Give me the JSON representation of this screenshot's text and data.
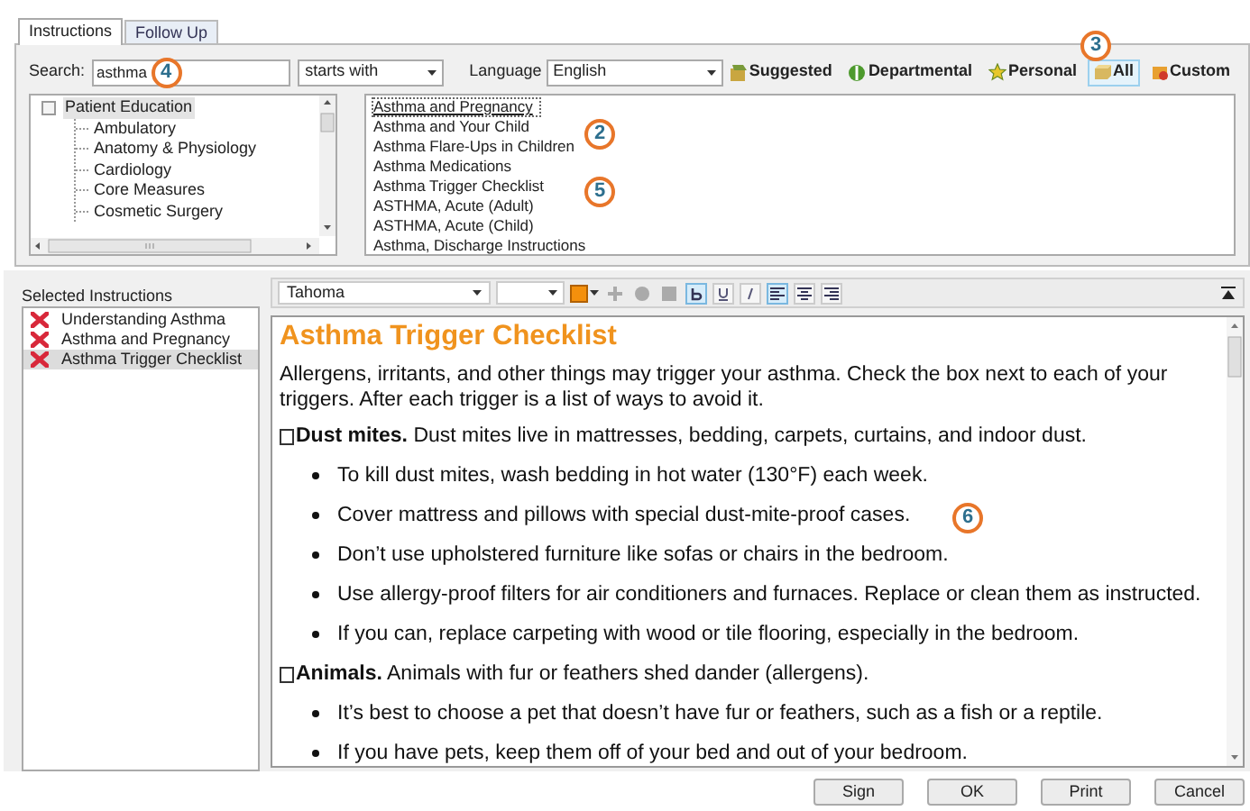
{
  "tabs": [
    {
      "label": "Instructions",
      "selected": true
    },
    {
      "label": "Follow Up",
      "selected": false
    }
  ],
  "search": {
    "label": "Search:",
    "value": "asthma",
    "match": "starts with"
  },
  "language": {
    "label": "Language",
    "value": "English"
  },
  "filters": [
    {
      "label": "Suggested",
      "selected": false
    },
    {
      "label": "Departmental",
      "selected": false
    },
    {
      "label": "Personal",
      "selected": false
    },
    {
      "label": "All",
      "selected": true
    },
    {
      "label": "Custom",
      "selected": false
    }
  ],
  "tree": {
    "label": "Patient Education",
    "checked": false,
    "children": [
      {
        "label": "Ambulatory"
      },
      {
        "label": "Anatomy & Physiology"
      },
      {
        "label": "Cardiology"
      },
      {
        "label": "Core Measures"
      },
      {
        "label": "Cosmetic Surgery"
      }
    ]
  },
  "results": [
    {
      "label": "Asthma and Pregnancy",
      "selected": true
    },
    {
      "label": "Asthma and Your Child",
      "selected": false
    },
    {
      "label": "Asthma Flare-Ups in Children",
      "selected": false
    },
    {
      "label": "Asthma Medications",
      "selected": false
    },
    {
      "label": "Asthma Trigger Checklist",
      "selected": false
    },
    {
      "label": "ASTHMA, Acute (Adult)",
      "selected": false
    },
    {
      "label": "ASTHMA, Acute (Child)",
      "selected": false
    },
    {
      "label": "Asthma, Discharge Instructions",
      "selected": false
    }
  ],
  "selected_instructions": {
    "title": "Selected Instructions",
    "items": [
      {
        "label": "Understanding Asthma",
        "selected": false
      },
      {
        "label": "Asthma and Pregnancy",
        "selected": false
      },
      {
        "label": "Asthma Trigger Checklist",
        "selected": true
      }
    ]
  },
  "editor_toolbar": {
    "font": "Tahoma",
    "bold": true,
    "underline": false,
    "italic": false,
    "align_left": true,
    "align_center": false,
    "align_right": false
  },
  "document": {
    "title": "Asthma Trigger Checklist",
    "blocks": [
      {
        "kind": "para",
        "text": "Allergens, irritants, and other things may trigger your asthma. Check the box next to each of your triggers. After each trigger is a list of ways to avoid it."
      },
      {
        "kind": "check",
        "checked": false,
        "text": "**Dust mites.** Dust mites live in mattresses, bedding, carpets, curtains, and indoor dust."
      },
      {
        "kind": "bullet",
        "text": "To kill dust mites, wash bedding in hot water (130°F) each week."
      },
      {
        "kind": "bullet",
        "text": "Cover mattress and pillows with special dust-mite-proof cases."
      },
      {
        "kind": "bullet",
        "text": "Don’t use upholstered furniture like sofas or chairs in the bedroom."
      },
      {
        "kind": "bullet",
        "text": "Use allergy-proof filters for air conditioners and furnaces. Replace or clean them as instructed."
      },
      {
        "kind": "bullet",
        "text": "If you can, replace carpeting with wood or tile flooring, especially in the bedroom."
      },
      {
        "kind": "check",
        "checked": false,
        "text": "**Animals.** Animals with fur or feathers shed dander (allergens)."
      },
      {
        "kind": "bullet",
        "text": "It’s best to choose a pet that doesn’t have fur or feathers, such as a fish or a reptile."
      },
      {
        "kind": "bullet",
        "text": "If you have pets, keep them off of your bed and out of your bedroom."
      }
    ]
  },
  "callouts": [
    {
      "label": "4"
    },
    {
      "label": "2"
    },
    {
      "label": "5"
    },
    {
      "label": "3"
    },
    {
      "label": "6"
    }
  ],
  "buttons": [
    "Sign",
    "OK",
    "Print",
    "Cancel"
  ]
}
